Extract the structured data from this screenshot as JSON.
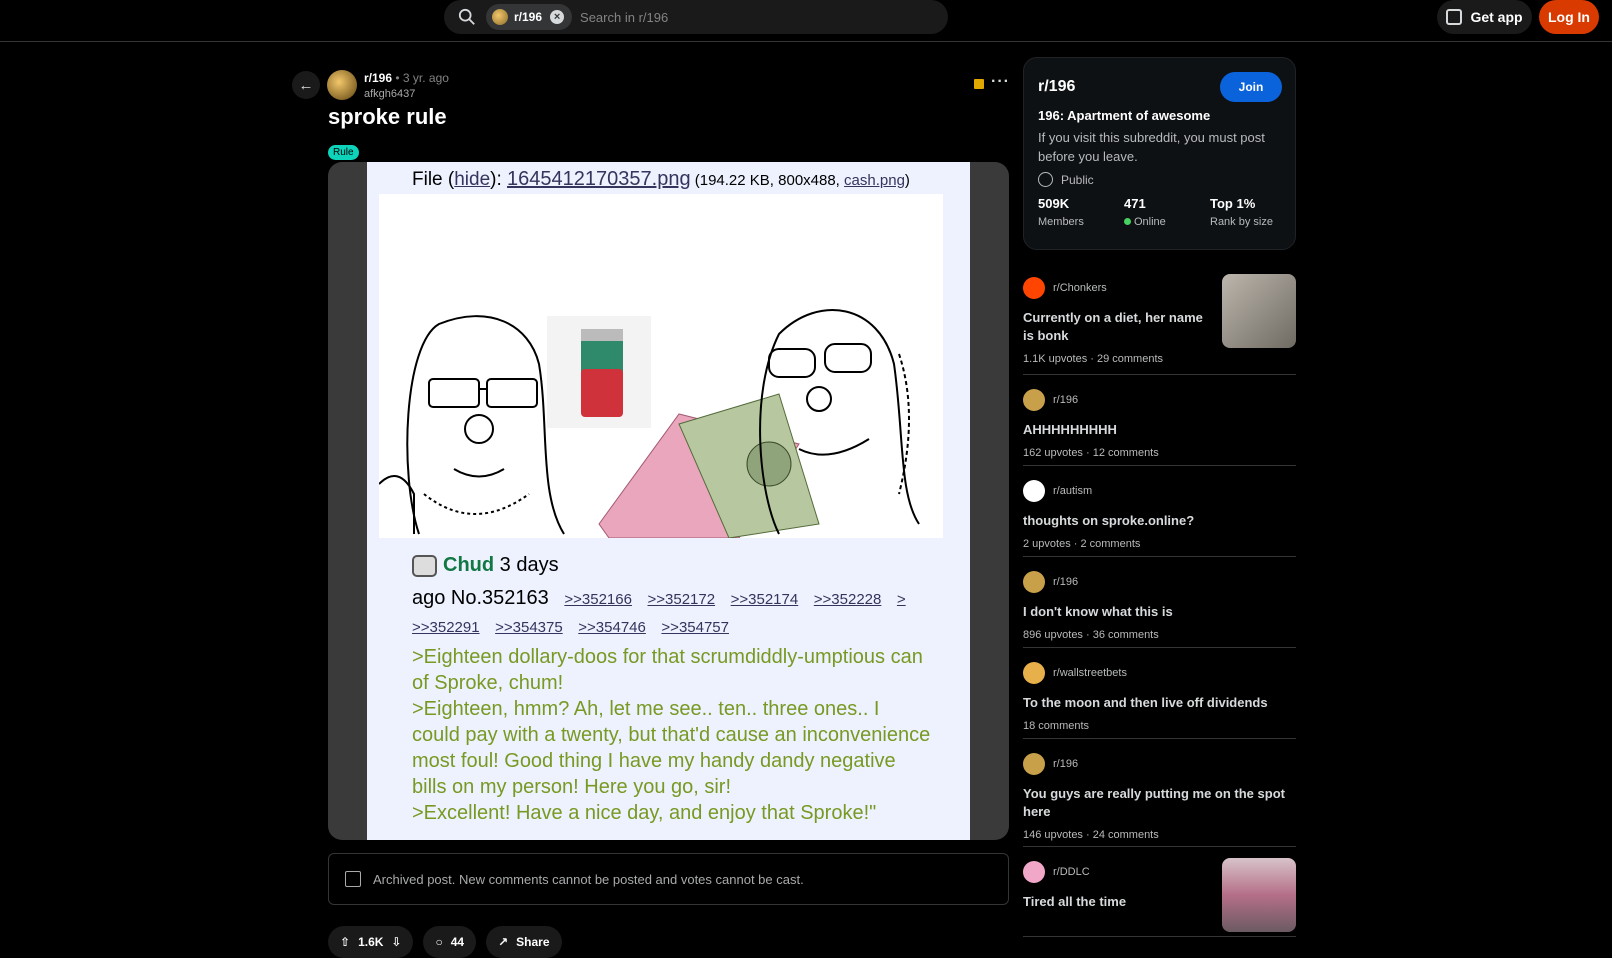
{
  "topbar": {
    "search_chip": "r/196",
    "search_placeholder": "Search in r/196",
    "get_app": "Get app",
    "login": "Log In"
  },
  "post": {
    "subreddit": "r/196",
    "age": "• 3 yr. ago",
    "author": "afkgh6437",
    "title": "sproke rule",
    "flair": "Rule",
    "archived_notice": "Archived post. New comments cannot be posted and votes cannot be cast.",
    "upvotes": "1.6K",
    "comments": "44",
    "share": "Share"
  },
  "image_content": {
    "file_label": "File (",
    "hide": "hide",
    "file_sep": "): ",
    "filename": "1645412170357.png",
    "file_info_pre": " (194.22 KB, 800x488, ",
    "file_orig": "cash.png",
    "file_info_post": ")",
    "name": "Chud",
    "time_part1": " 3 days",
    "time_part2": "ago No.352163",
    "refs": [
      ">>352166",
      ">>352172",
      ">>352174",
      ">>352228",
      ">",
      ">>352291",
      ">>354375",
      ">>354746",
      ">>354757"
    ],
    "greentext": ">Eighteen dollary-doos for that scrumdiddly-umptious can of Sproke, chum!\n>Eighteen, hmm? Ah, let me see.. ten.. three ones.. I could pay with a twenty, but that'd cause an inconvenience most foul! Good thing I have my handy dandy negative bills on my person! Here you go, sir!\n>Excellent! Have a nice day, and enjoy that Sproke!\""
  },
  "sidebar": {
    "name": "r/196",
    "join": "Join",
    "desc_title": "196: Apartment of awesome",
    "desc": "If you visit this subreddit, you must post before you leave.",
    "visibility": "Public",
    "members_value": "509K",
    "members_label": "Members",
    "online_value": "471",
    "online_label": "Online",
    "rank_value": "Top 1%",
    "rank_label": "Rank by size"
  },
  "feed": [
    {
      "sub": "r/Chonkers",
      "title": "Currently on a diet, her name is bonk",
      "stats": "1.1K upvotes · 29 comments",
      "icon_color": "#ff4500",
      "thumb": true
    },
    {
      "sub": "r/196",
      "title": "AHHHHHHHHH",
      "stats": "162 upvotes · 12 comments",
      "icon_color": "#c9a04a",
      "thumb": false
    },
    {
      "sub": "r/autism",
      "title": "thoughts on sproke.online?",
      "stats": "2 upvotes · 2 comments",
      "icon_color": "#ffffff",
      "thumb": false
    },
    {
      "sub": "r/196",
      "title": "I don't know what this is",
      "stats": "896 upvotes · 36 comments",
      "icon_color": "#c9a04a",
      "thumb": false
    },
    {
      "sub": "r/wallstreetbets",
      "title": "To the moon and then live off dividends",
      "stats": "18 comments",
      "icon_color": "#e8b04a",
      "thumb": false
    },
    {
      "sub": "r/196",
      "title": "You guys are really putting me on the spot here",
      "stats": "146 upvotes · 24 comments",
      "icon_color": "#c9a04a",
      "thumb": false
    },
    {
      "sub": "r/DDLC",
      "title": "Tired all the time",
      "stats": "",
      "icon_color": "#f1a8c8",
      "thumb": true
    }
  ]
}
